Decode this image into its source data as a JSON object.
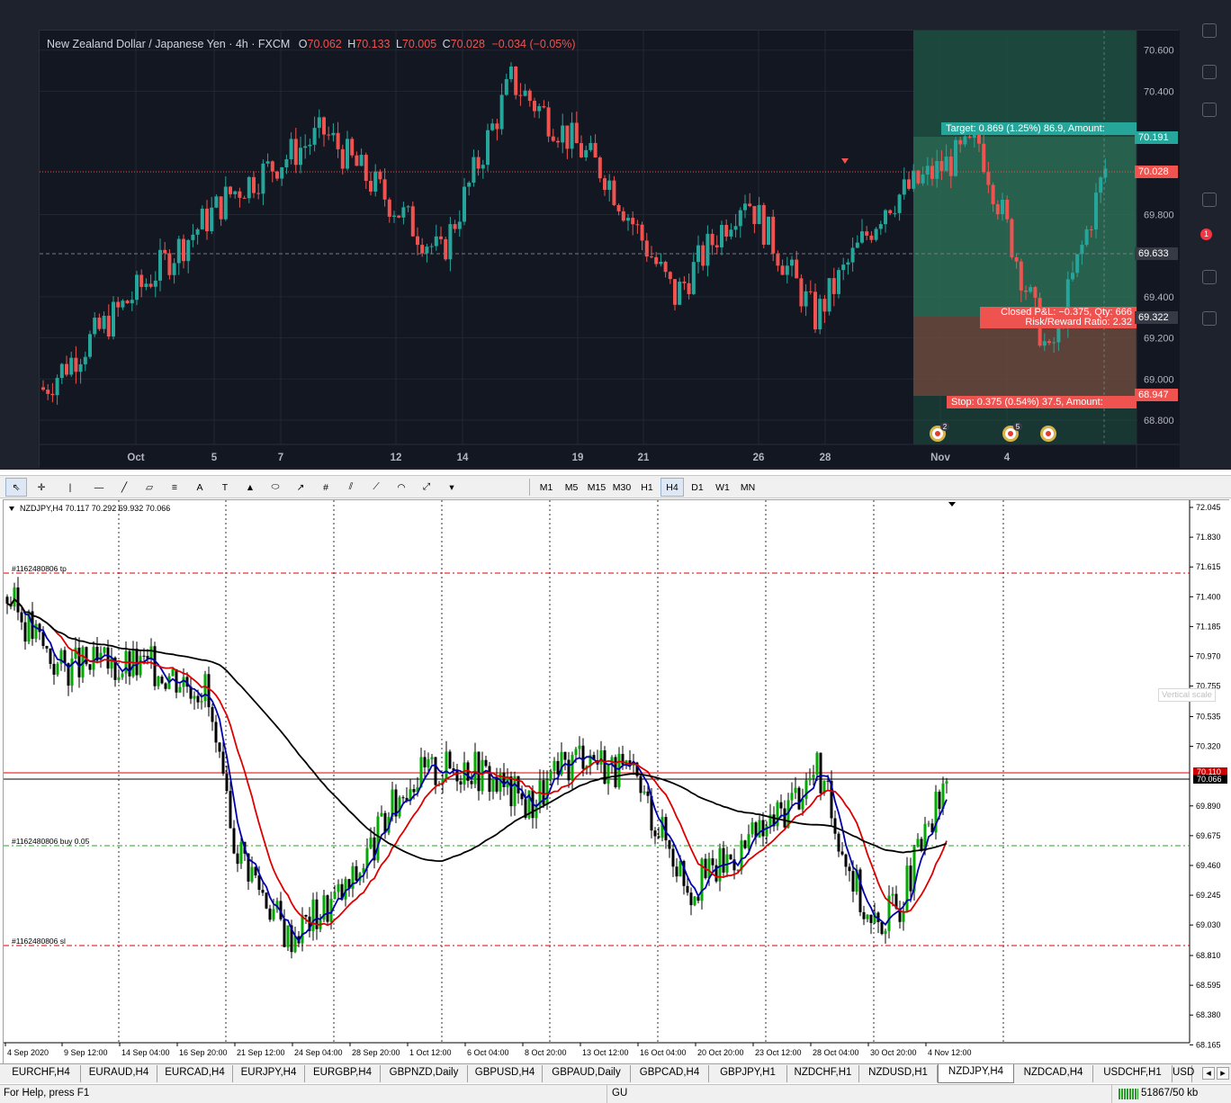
{
  "tradingview": {
    "symbol_title": "New Zealand Dollar / Japanese Yen · 4h · FXCM",
    "ohlc": {
      "o_label": "O",
      "o": "70.062",
      "h_label": "H",
      "h": "70.133",
      "l_label": "L",
      "l": "70.005",
      "c_label": "C",
      "c": "70.028",
      "change": "−0.034 (−0.05%)"
    },
    "price_ticks": [
      "70.600",
      "70.400",
      "69.800",
      "69.400",
      "69.200",
      "69.000",
      "68.800"
    ],
    "time_ticks": [
      "Oct",
      "5",
      "7",
      "12",
      "14",
      "19",
      "21",
      "26",
      "28",
      "Nov",
      "4"
    ],
    "price_labels": {
      "target": "70.191",
      "current": "70.028",
      "dashed": "69.633",
      "entry": "69.322",
      "stop": "68.947"
    },
    "target_text": "Target: 0.869 (1.25%) 86.9, Amount:",
    "stop_text": "Stop: 0.375 (0.54%) 37.5, Amount:",
    "closed_pnl": "Closed P&L: −0.375, Qty: 666",
    "rr_ratio": "Risk/Reward Ratio: 2.32",
    "event_badges": [
      "2",
      "5"
    ],
    "notification_count": "1",
    "colors": {
      "up": "#26a69a",
      "down": "#ef5350",
      "bg": "#131722",
      "target_zone": "#2e7d5b",
      "stop_zone": "#7a5040"
    }
  },
  "mt4_toolbar": {
    "timeframes": [
      "M1",
      "M5",
      "M15",
      "M30",
      "H1",
      "H4",
      "D1",
      "W1",
      "MN"
    ],
    "selected_timeframe": "H4",
    "tool_icons": [
      "cursor-icon",
      "crosshair-icon",
      "vertical-line-icon",
      "horizontal-line-icon",
      "trendline-icon",
      "equidistant-channel-icon",
      "fibonacci-retracement-icon",
      "text-icon",
      "text-label-icon",
      "triangle-icon",
      "ellipse-icon",
      "arrow-icon",
      "gann-icon",
      "channel-icon",
      "fibo-fan-icon",
      "fibo-arcs-icon",
      "fibo-expansion-icon",
      "arrows-menu-icon"
    ],
    "text_tool_label": "A"
  },
  "mt4_chart": {
    "header": "NZDJPY,H4  70.117 70.292 69.932 70.066",
    "price_ticks": [
      "72.045",
      "71.830",
      "71.615",
      "71.400",
      "71.185",
      "70.970",
      "70.755",
      "70.535",
      "70.320",
      "69.890",
      "69.675",
      "69.460",
      "69.245",
      "69.030",
      "68.810",
      "68.595",
      "68.380",
      "68.165"
    ],
    "price_tags": {
      "bid": "70.110",
      "current": "70.066"
    },
    "time_ticks": [
      "4 Sep 2020",
      "9 Sep 12:00",
      "14 Sep 04:00",
      "16 Sep 20:00",
      "21 Sep 12:00",
      "24 Sep 04:00",
      "28 Sep 20:00",
      "1 Oct 12:00",
      "6 Oct 04:00",
      "8 Oct 20:00",
      "13 Oct 12:00",
      "16 Oct 04:00",
      "20 Oct 20:00",
      "23 Oct 12:00",
      "28 Oct 04:00",
      "30 Oct 20:00",
      "4 Nov 12:00"
    ],
    "order_lines": {
      "tp": "#1162480806 tp",
      "buy": "#1162480806 buy 0.05",
      "sl": "#1162480806 sl"
    },
    "tooltip": "Vertical scale",
    "colors": {
      "ma_fast": "#0000aa",
      "ma_mid": "#dd0000",
      "ma_slow": "#000000"
    }
  },
  "symbol_tabs": [
    "EURCHF,H4",
    "EURAUD,H4",
    "EURCAD,H4",
    "EURJPY,H4",
    "EURGBP,H4",
    "GBPNZD,Daily",
    "GBPUSD,H4",
    "GBPAUD,Daily",
    "GBPCAD,H4",
    "GBPJPY,H1",
    "NZDCHF,H1",
    "NZDUSD,H1",
    "NZDJPY,H4",
    "NZDCAD,H4",
    "USDCHF,H1",
    "USD"
  ],
  "active_tab": "NZDJPY,H4",
  "status": {
    "help": "For Help, press F1",
    "profile": "GU",
    "traffic": "51867/50 kb"
  }
}
